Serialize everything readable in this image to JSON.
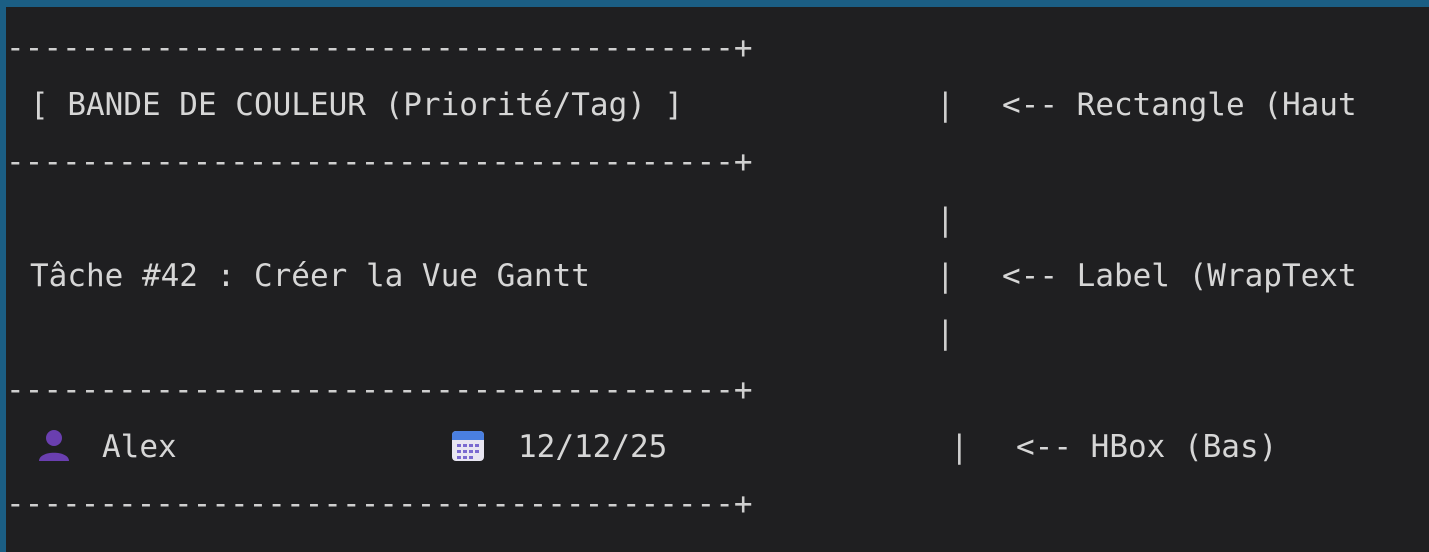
{
  "separator": "---------------------------------------+",
  "rows": {
    "header": {
      "content": "[ BANDE DE COULEUR (Priorité/Tag) ]",
      "pipe": "|",
      "note": "<-- Rectangle (Haut"
    },
    "label_pipe_top": "|",
    "label": {
      "content": "Tâche #42 : Créer la Vue Gantt",
      "pipe": "|",
      "note": "<-- Label (WrapText"
    },
    "label_pipe_bottom": "|",
    "footer": {
      "user_icon": "user-icon",
      "user_name": "Alex",
      "calendar_icon": "calendar-icon",
      "date": "12/12/25",
      "pipe": "|",
      "note": "<-- HBox (Bas)"
    }
  },
  "colors": {
    "background": "#1f1f21",
    "border": "#1b5e84",
    "text": "#d6d6d6",
    "user_icon": "#6a3fb0",
    "calendar_icon": "#4a7fe0"
  }
}
